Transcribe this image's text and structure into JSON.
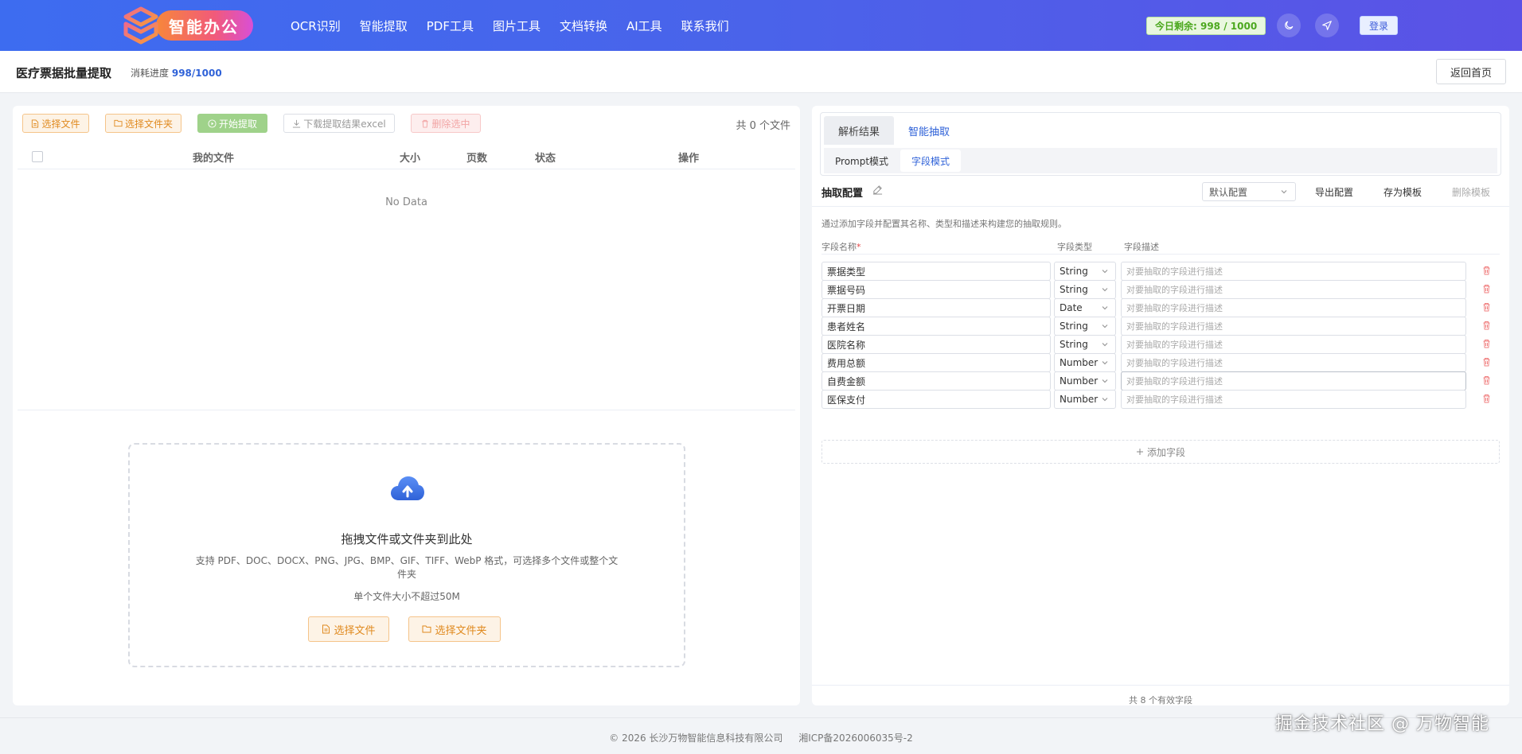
{
  "header": {
    "brand": "智能办公",
    "nav": [
      "OCR识别",
      "智能提取",
      "PDF工具",
      "图片工具",
      "文档转换",
      "AI工具",
      "联系我们"
    ],
    "quota": "今日剩余: 998 / 1000",
    "login": "登录"
  },
  "subbar": {
    "title": "医疗票据批量提取",
    "progress_label": "消耗进度",
    "progress_value": "998/1000",
    "home": "返回首页"
  },
  "left": {
    "toolbar": {
      "select_file": "选择文件",
      "select_folder": "选择文件夹",
      "start": "开始提取",
      "download": "下载提取结果excel",
      "delete": "删除选中"
    },
    "file_count": "共 0 个文件",
    "columns": {
      "name": "我的文件",
      "size": "大小",
      "pages": "页数",
      "status": "状态",
      "action": "操作"
    },
    "empty": "No Data",
    "dropzone": {
      "title": "拖拽文件或文件夹到此处",
      "desc": "支持 PDF、DOC、DOCX、PNG、JPG、BMP、GIF、TIFF、WebP 格式，可选择多个文件或整个文件夹",
      "limit": "单个文件大小不超过50M",
      "select_file": "选择文件",
      "select_folder": "选择文件夹"
    }
  },
  "right": {
    "tabs": [
      "解析结果",
      "智能抽取"
    ],
    "subtabs": [
      "Prompt模式",
      "字段模式"
    ],
    "config": {
      "title": "抽取配置",
      "preset": "默认配置",
      "export": "导出配置",
      "save": "存为模板",
      "delete": "删除模板",
      "hint": "通过添加字段并配置其名称、类型和描述来构建您的抽取规则。"
    },
    "columns": {
      "name": "字段名称",
      "required_mark": "*",
      "type": "字段类型",
      "desc": "字段描述"
    },
    "fields": [
      {
        "name": "票据类型",
        "type": "String",
        "placeholder": "对要抽取的字段进行描述"
      },
      {
        "name": "票据号码",
        "type": "String",
        "placeholder": "对要抽取的字段进行描述"
      },
      {
        "name": "开票日期",
        "type": "Date",
        "placeholder": "对要抽取的字段进行描述"
      },
      {
        "name": "患者姓名",
        "type": "String",
        "placeholder": "对要抽取的字段进行描述"
      },
      {
        "name": "医院名称",
        "type": "String",
        "placeholder": "对要抽取的字段进行描述"
      },
      {
        "name": "费用总额",
        "type": "Number",
        "placeholder": "对要抽取的字段进行描述"
      },
      {
        "name": "自费金额",
        "type": "Number",
        "placeholder": "对要抽取的字段进行描述"
      },
      {
        "name": "医保支付",
        "type": "Number",
        "placeholder": "对要抽取的字段进行描述"
      }
    ],
    "add_field": "添加字段",
    "valid_count": "共 8 个有效字段"
  },
  "footer": {
    "copyright": "© 2026 长沙万物智能信息科技有限公司",
    "icp": "湘ICP备2026006035号-2",
    "watermark": "掘金技术社区 @ 万物智能"
  },
  "colors": {
    "header_start": "#3d6cf0",
    "header_end": "#5b52e6",
    "accent_blue": "#2f62d8",
    "orange": "#e08a1f",
    "green": "#9fd28a",
    "quota_green": "#4ca81f"
  }
}
